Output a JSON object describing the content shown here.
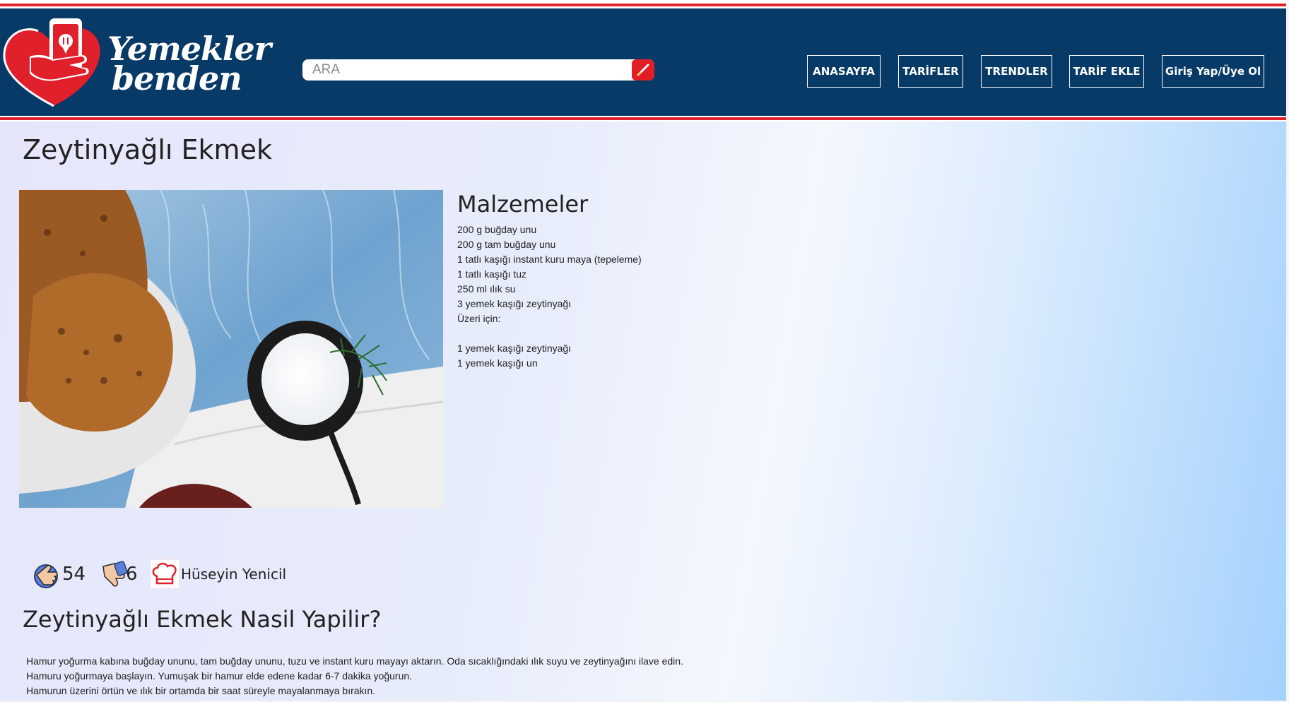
{
  "header": {
    "logo_line1": "Yemekler",
    "logo_line2": "benden",
    "search_placeholder": "ARA",
    "colors": {
      "band": "#083a68",
      "accent": "#e0202a"
    },
    "nav": [
      {
        "label": "ANASAYFA"
      },
      {
        "label": "TARİFLER"
      },
      {
        "label": "TRENDLER"
      },
      {
        "label": "TARİF EKLE"
      },
      {
        "label": "Giriş Yap/Üye Ol"
      }
    ]
  },
  "recipe": {
    "title": "Zeytinyağlı Ekmek",
    "ingredients_title": "Malzemeler",
    "ingredients": [
      "200 g buğday unu",
      "200 g tam buğday unu",
      "1 tatlı kaşığı instant kuru maya (tepeleme)",
      "1 tatlı kaşığı tuz",
      "250 ml ılık su",
      "3 yemek kaşığı  zeytinyağı",
      "Üzeri için:",
      "",
      "1 yemek kaşığı zeytinyağı",
      "1 yemek kaşığı un"
    ],
    "likes": "54",
    "dislikes": "6",
    "author": "Hüseyin Yenicil",
    "howto_title": "Zeytinyağlı Ekmek Nasil Yapilir?",
    "steps": [
      "Hamur yoğurma kabına buğday ununu, tam buğday ununu, tuzu ve instant kuru mayayı aktarın. Oda sıcaklığındaki ılık suyu ve zeytinyağını ilave edin.",
      "Hamuru yoğurmaya başlayın. Yumuşak bir hamur elde edene kadar 6-7 dakika yoğurun.",
      "Hamurun üzerini örtün ve ılık bir ortamda bir saat süreyle mayalanmaya bırakın."
    ]
  },
  "icons": {
    "logo": "heart-phone-logo-icon",
    "search": "pencil-search-icon",
    "like": "thumbs-up-icon",
    "dislike": "thumbs-down-icon",
    "author": "chef-hat-icon"
  }
}
